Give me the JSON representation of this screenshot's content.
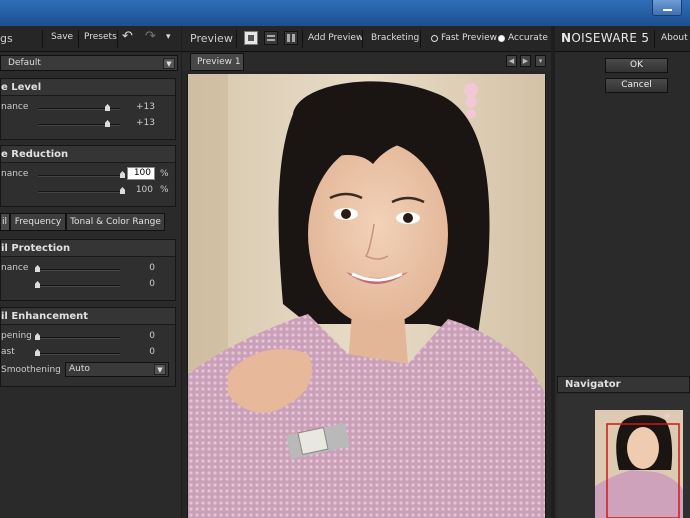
{
  "left_panel": {
    "title": "gs",
    "save": "Save",
    "presets": "Presets",
    "undo": "↶",
    "redo": "↷",
    "menu": "▾",
    "preset_value": "Default",
    "noise_level": {
      "title": "e Level",
      "rows": [
        {
          "label": "nance",
          "value": "+13",
          "level": 0.85
        },
        {
          "label": "",
          "value": "+13",
          "level": 0.85
        }
      ]
    },
    "noise_reduction": {
      "title": "e Reduction",
      "rows": [
        {
          "label": "nance",
          "value": "100",
          "unit": "%",
          "level": 1.0
        },
        {
          "label": "",
          "value": "100",
          "unit": "%",
          "level": 1.0
        }
      ]
    },
    "tabs": [
      "il",
      "Frequency",
      "Tonal & Color Range"
    ],
    "detail_protection": {
      "title": "il Protection",
      "rows": [
        {
          "label": "nance",
          "value": "0",
          "level": 0.0
        },
        {
          "label": "",
          "value": "0",
          "level": 0.0
        }
      ]
    },
    "detail_enhancement": {
      "title": "il Enhancement",
      "rows": [
        {
          "label": "pening",
          "value": "0",
          "level": 0.0
        },
        {
          "label": "ast",
          "value": "0",
          "level": 0.0
        }
      ],
      "smoothening_label": "Smoothening",
      "smoothening_value": "Auto"
    }
  },
  "preview": {
    "label": "Preview",
    "add_preview": "Add Preview",
    "bracketing": "Bracketing",
    "fast_preview": "Fast Preview",
    "accurate": "Accurate",
    "tab": "Preview 1",
    "prev_arrow": "◀",
    "next_arrow": "▶",
    "menu_arrow": "▾"
  },
  "right_panel": {
    "brand_big": "N",
    "brand_rest": "OISEWARE 5",
    "about": "About",
    "ok": "OK",
    "cancel": "Cancel",
    "navigator": "Navigator"
  },
  "colors": {
    "accent_selection": "#d01818",
    "titlebar": "#2f6fb8"
  }
}
